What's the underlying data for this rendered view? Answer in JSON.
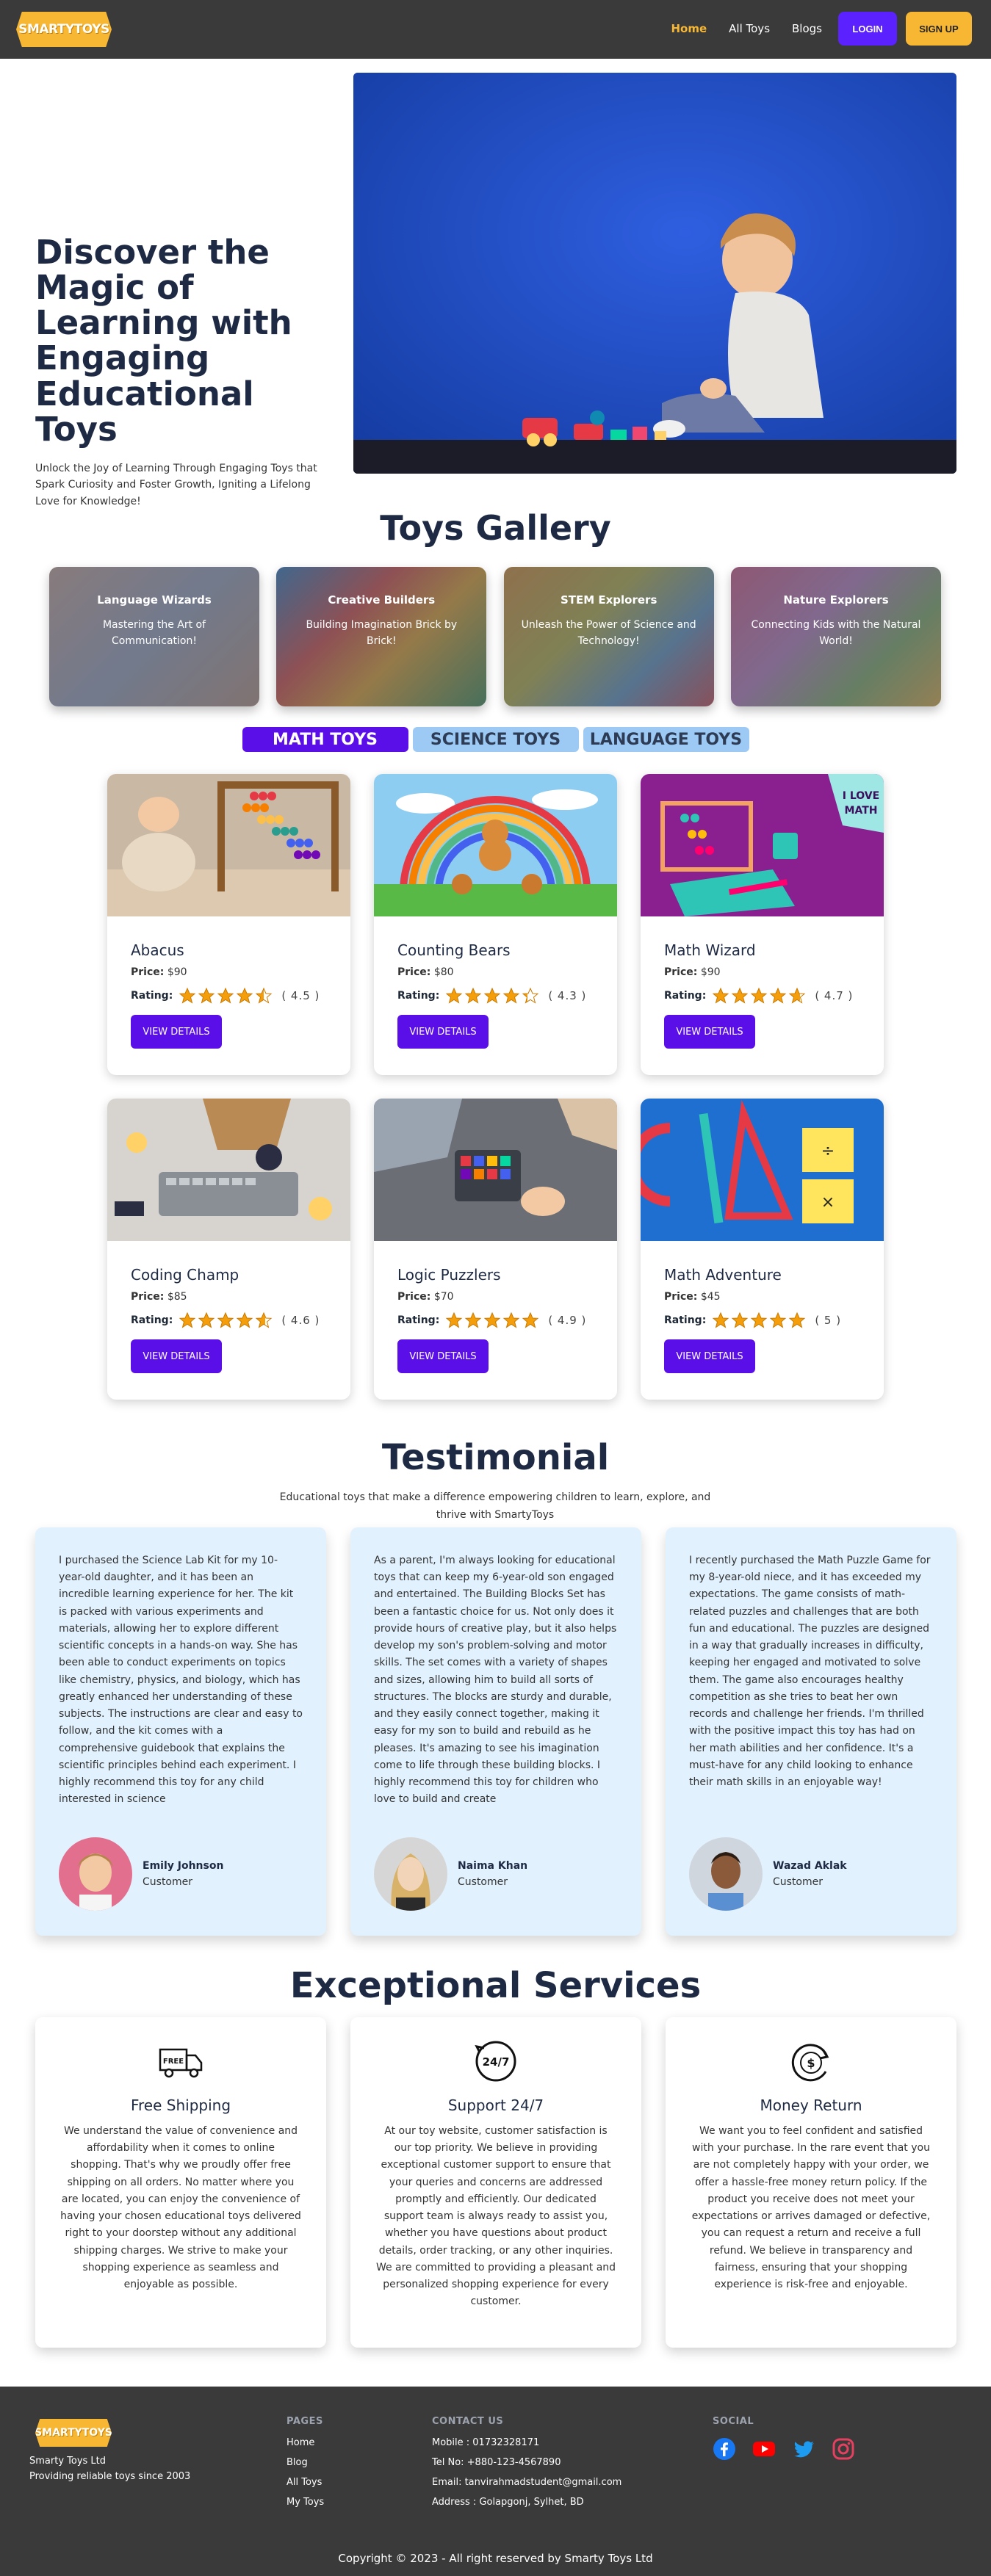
{
  "nav": {
    "logo": "SMARTYTOYS",
    "links": [
      "Home",
      "All Toys",
      "Blogs"
    ],
    "login": "LOGIN",
    "signup": "SIGN UP"
  },
  "hero": {
    "title": "Discover the Magic of Learning with Engaging Educational Toys",
    "subtitle": "Unlock the Joy of Learning Through Engaging Toys that Spark Curiosity and Foster Growth, Igniting a Lifelong Love for Knowledge!"
  },
  "gallery": {
    "title": "Toys Gallery",
    "cards": [
      {
        "title": "Language Wizards",
        "text": "Mastering the Art of Communication!"
      },
      {
        "title": "Creative Builders",
        "text": "Building Imagination Brick by Brick!"
      },
      {
        "title": "STEM Explorers",
        "text": "Unleash the Power of Science and Technology!"
      },
      {
        "title": "Nature Explorers",
        "text": "Connecting Kids with the Natural World!"
      }
    ]
  },
  "tabs": [
    "MATH TOYS",
    "SCIENCE TOYS",
    "LANGUAGE TOYS"
  ],
  "products": {
    "price_label": "Price:",
    "rating_label": "Rating:",
    "button": "VIEW DETAILS",
    "items": [
      {
        "name": "Abacus",
        "price": "$90",
        "rating": 4.5,
        "rating_text": "( 4.5 )"
      },
      {
        "name": "Counting Bears",
        "price": "$80",
        "rating": 4.3,
        "rating_text": "( 4.3 )"
      },
      {
        "name": "Math Wizard",
        "price": "$90",
        "rating": 4.7,
        "rating_text": "( 4.7 )"
      },
      {
        "name": "Coding Champ",
        "price": "$85",
        "rating": 4.6,
        "rating_text": "( 4.6 )"
      },
      {
        "name": "Logic Puzzlers",
        "price": "$70",
        "rating": 4.9,
        "rating_text": "( 4.9 )"
      },
      {
        "name": "Math Adventure",
        "price": "$45",
        "rating": 5,
        "rating_text": "( 5 )"
      }
    ],
    "image_text": {
      "love_math": "I LOVE MATH"
    }
  },
  "testimonial": {
    "title": "Testimonial",
    "subtitle": "Educational toys that make a difference empowering children to learn, explore, and thrive with SmartyToys",
    "items": [
      {
        "text": "I purchased the Science Lab Kit for my 10-year-old daughter, and it has been an incredible learning experience for her. The kit is packed with various experiments and materials, allowing her to explore different scientific concepts in a hands-on way. She has been able to conduct experiments on topics like chemistry, physics, and biology, which has greatly enhanced her understanding of these subjects. The instructions are clear and easy to follow, and the kit comes with a comprehensive guidebook that explains the scientific principles behind each experiment. I highly recommend this toy for any child interested in science",
        "name": "Emily Johnson",
        "role": "Customer"
      },
      {
        "text": "As a parent, I'm always looking for educational toys that can keep my 6-year-old son engaged and entertained. The Building Blocks Set has been a fantastic choice for us. Not only does it provide hours of creative play, but it also helps develop my son's problem-solving and motor skills. The set comes with a variety of shapes and sizes, allowing him to build all sorts of structures. The blocks are sturdy and durable, and they easily connect together, making it easy for my son to build and rebuild as he pleases. It's amazing to see his imagination come to life through these building blocks. I highly recommend this toy for children who love to build and create",
        "name": "Naima Khan",
        "role": "Customer"
      },
      {
        "text": "I recently purchased the Math Puzzle Game for my 8-year-old niece, and it has exceeded my expectations. The game consists of math-related puzzles and challenges that are both fun and educational. The puzzles are designed in a way that gradually increases in difficulty, keeping her engaged and motivated to solve them. The game also encourages healthy competition as she tries to beat her own records and challenge her friends. I'm thrilled with the positive impact this toy has had on her math abilities and her confidence. It's a must-have for any child looking to enhance their math skills in an enjoyable way!",
        "name": "Wazad Aklak",
        "role": "Customer"
      }
    ]
  },
  "services": {
    "title": "Exceptional Services",
    "items": [
      {
        "icon": "free-shipping-icon",
        "icon_text": "FREE",
        "title": "Free Shipping",
        "text": "We understand the value of convenience and affordability when it comes to online shopping. That's why we proudly offer free shipping on all orders. No matter where you are located, you can enjoy the convenience of having your chosen educational toys delivered right to your doorstep without any additional shipping charges. We strive to make your shopping experience as seamless and enjoyable as possible."
      },
      {
        "icon": "support-24-7-icon",
        "icon_text": "24/7",
        "title": "Support 24/7",
        "text": "At our toy website, customer satisfaction is our top priority. We believe in providing exceptional customer support to ensure that your queries and concerns are addressed promptly and efficiently. Our dedicated support team is always ready to assist you, whether you have questions about product details, order tracking, or any other inquiries. We are committed to providing a pleasant and personalized shopping experience for every customer."
      },
      {
        "icon": "money-return-icon",
        "title": "Money Return",
        "text": "We want you to feel confident and satisfied with your purchase. In the rare event that you are not completely happy with your order, we offer a hassle-free money return policy. If the product you receive does not meet your expectations or arrives damaged or defective, you can request a return and receive a full refund. We believe in transparency and fairness, ensuring that your shopping experience is risk-free and enjoyable."
      }
    ]
  },
  "footer": {
    "logo": "SMARTYTOYS",
    "brand_name": "Smarty Toys Ltd",
    "brand_tagline": "Providing reliable toys since 2003",
    "pages_heading": "PAGES",
    "pages": [
      "Home",
      "Blog",
      "All Toys",
      "My Toys"
    ],
    "contact_heading": "CONTACT US",
    "contact": [
      "Mobile : 01732328171",
      "Tel No: +880-123-4567890",
      "Email: tanvirahmadstudent@gmail.com",
      "Address : Golapgonj, Sylhet, BD"
    ],
    "social_heading": "SOCIAL",
    "socials": [
      "facebook-icon",
      "youtube-icon",
      "twitter-icon",
      "instagram-icon"
    ],
    "copyright": "Copyright © 2023 - All right reserved by Smarty Toys Ltd"
  },
  "colors": {
    "accent": "#5b0fe8",
    "brand_yellow": "#f7b733",
    "nav_bg": "#3a3a3a",
    "tab_inactive": "#9ccaf5",
    "testimonial_bg": "#e1f1fd",
    "star": "#f59e0b"
  }
}
